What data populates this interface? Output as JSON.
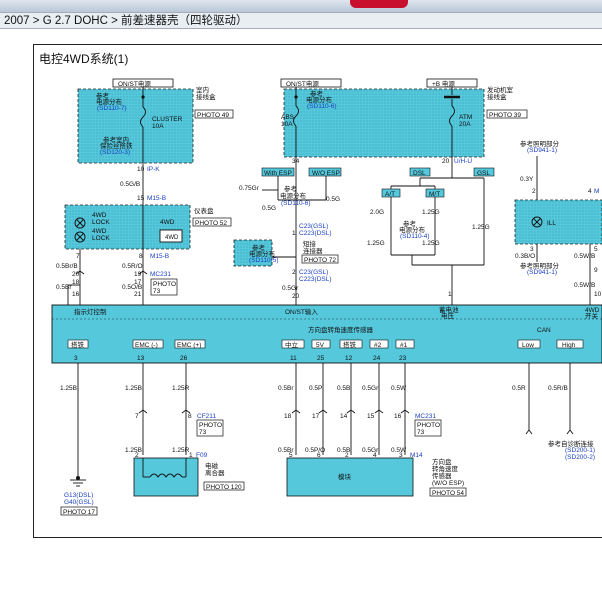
{
  "breadcrumb": "2007 > G 2.7 DOHC > 前差速器壳（四轮驱动）",
  "diagram_title": "电控4WD系统(1)",
  "power": {
    "on_st_left": "ON/ST电源",
    "on_st_mid": "ON/ST电源",
    "b_plus": "+B 电源"
  },
  "fuse_cluster": {
    "ref": "参考",
    "ref2": "电源分布",
    "sd": "(SD110-7)",
    "name": "CLUSTER",
    "amp": "10A",
    "ref_bottom": "参考室内",
    "ref_bottom2": "保险丝搭铁",
    "sd_bottom": "(SD120-3)"
  },
  "indoor_box": {
    "line1": "室内",
    "line2": "接线盒",
    "photo": "PHOTO 49"
  },
  "engine_box": {
    "line1": "发动机室",
    "line2": "接线盒",
    "photo": "PHOTO 39",
    "ref": "参考",
    "ref2": "电源分布",
    "sd": "(SD110-6)",
    "abs": "ABS",
    "abs_amp": "10A",
    "atm": "ATM",
    "atm_amp": "20A"
  },
  "conn": {
    "ipk": "IP-K",
    "uh": "U/H-U",
    "m15b": "M15-B",
    "m15b2": "M15-B",
    "mc231": "MC231",
    "mc231b": "MC231",
    "photo73": "PHOTO",
    "photo73b": "73",
    "cf211": "CF211",
    "cf211_photo": "PHOTO",
    "cf211_photo2": "73",
    "f09": "F09",
    "m14": "M14",
    "c23": "C23(GSL)",
    "c223": "C223(DSL)",
    "c23b": "C23(GSL)",
    "c223b": "C223(DSL)"
  },
  "pins": {
    "p10": "10",
    "p15": "15",
    "p7": "7",
    "p8": "8",
    "p20": "20",
    "p18": "18",
    "p16": "16",
    "p19": "19",
    "p17": "17",
    "p21": "21",
    "p34": "34",
    "p1": "1",
    "p2": "2",
    "p20b": "20",
    "p13": "13",
    "p26": "26",
    "p3": "3",
    "p11": "11",
    "p25": "25",
    "p12": "12",
    "p24": "24",
    "p23": "23",
    "p7b": "7",
    "p8b": "8",
    "p18b": "18",
    "p17b": "17",
    "p14": "14",
    "p15b": "15",
    "p16b": "16",
    "p2b": "2",
    "p1b": "1",
    "p5": "5",
    "p6": "6",
    "p2c": "2",
    "p4": "4",
    "p3b": "3",
    "p4b": "4",
    "p2d": "2",
    "p5b": "5",
    "p10b": "10",
    "p9": "9",
    "p1c": "1",
    "p3c": "3"
  },
  "wires": {
    "w05gb": "0.5G/B",
    "w05brb": "0.5Br/B",
    "w05br": "0.5Br",
    "w05ro": "0.5R/O",
    "w05ob": "0.5O/B",
    "w05bb": "0.5B",
    "w075gr": "0.75Gr",
    "w05g": "0.5G",
    "w05g2": "0.5G",
    "w05gr": "0.5Gr",
    "w20g": "2.0G",
    "w125g": "1.25G",
    "w125g2": "1.25G",
    "w125g3": "1.25G",
    "w125g4": "1.25G",
    "w03y": "0.3Y",
    "w03bo": "0.3B/O",
    "w05wb": "0.5W/B",
    "w05wb2": "0.5W/B",
    "w125b": "1.25B",
    "w125b2": "1.25B",
    "w125b3": "1.25B",
    "w125r": "1.25R",
    "w125r2": "1.25R",
    "w05br2": "0.5Br",
    "w05p": "0.5P",
    "w05b3": "0.5B",
    "w05gr2": "0.5Gr",
    "w05w": "0.5W",
    "w05br3": "0.5Br",
    "w05po": "0.5P/O",
    "w05b4": "0.5B",
    "w05gr3": "0.5Gr",
    "w05w2": "0.5W",
    "w05r": "0.5R",
    "w05rb": "0.5R/B"
  },
  "labels": {
    "with_esp": "With ESP",
    "wo_esp": "W/O ESP",
    "dsl": "DSL",
    "gsl": "GSL",
    "at": "A/T",
    "mt": "M/T",
    "ref_sd1106": "参考",
    "ref_sd1106b": "电源分布",
    "ref_sd1106c": "(SD110-6)",
    "ref_sd1104": "参考",
    "ref_sd1104b": "电源分布",
    "ref_sd1104c": "(SD110-4)",
    "ref_sd1105": "参考",
    "ref_sd1105b": "电源分布",
    "ref_sd1105c": "(SD110-5)",
    "short_conn": "短接",
    "short_conn2": "连接器",
    "photo72": "PHOTO 72",
    "ref_light": "参考照明部分",
    "ref_light_sd": "(SD941-1)",
    "ref_light2": "参考照明部分",
    "ref_light2_sd": "(SD941-1)",
    "ill": "ILL",
    "m_label": "M",
    "cluster_label": "仪表盘",
    "photo52": "PHOTO 52",
    "lock1": "4WD",
    "lock1b": "LOCK",
    "lock2": "4WD",
    "lock2b": "LOCK",
    "fwd": "4WD",
    "ecu_ind": "指示灯控制",
    "ecu_onst": "ON/ST输入",
    "ecu_batt": "蓄电池",
    "ecu_batt2": "电压",
    "ecu_4wd": "4WD",
    "ecu_4wd2": "开关",
    "steer_sensor": "方向盘转角速度传感器",
    "can": "CAN",
    "can_low": "Low",
    "can_high": "High",
    "gnd": "搭铁",
    "emc_minus": "EMC (-)",
    "emc_plus": "EMC (+)",
    "mid": "中立",
    "v5": "5V",
    "gnd2": "搭铁",
    "n2": "#2",
    "n1": "#1",
    "ref_can": "参考自诊断连接",
    "ref_can_sd1": "(SD200-1)",
    "ref_can_sd2": "(SD200-2)",
    "g13": "G13(DSL)",
    "g40": "G40(GSL)",
    "photo17": "PHOTO 17",
    "clutch": "电磁",
    "clutch2": "离合器",
    "photo120": "PHOTO 120",
    "module": "模块",
    "sensor_title": "方向盘",
    "sensor_title2": "转角速度",
    "sensor_title3": "传感器",
    "sensor_title4": "(W/O ESP)",
    "photo54": "PHOTO 54"
  }
}
